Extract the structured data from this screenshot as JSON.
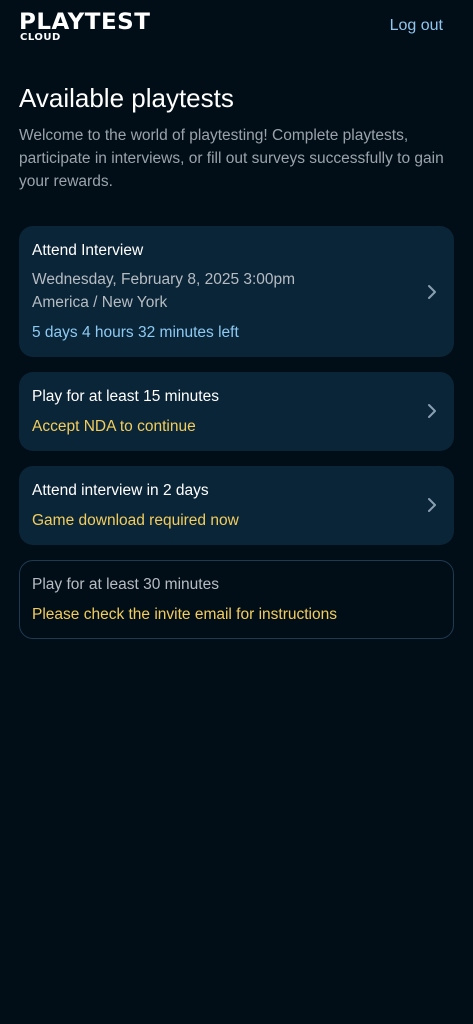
{
  "header": {
    "logo_main": "PLAYTEST",
    "logo_sub": "CLOUD",
    "logout_label": "Log out"
  },
  "page": {
    "title": "Available playtests",
    "intro": "Welcome to the world of playtesting! Complete playtests, participate in interviews, or fill out surveys successfully to gain your rewards."
  },
  "cards": [
    {
      "title": "Attend Interview",
      "date": "Wednesday, February 8, 2025 3:00pm",
      "timezone": "America / New York",
      "countdown": "5 days 4 hours 32 minutes left"
    },
    {
      "title": "Play for at least 15 minutes",
      "status": "Accept NDA to continue"
    },
    {
      "title": "Attend interview in 2 days",
      "status": "Game download required now"
    },
    {
      "title": "Play for at least 30 minutes",
      "status": "Please check the invite email for instructions"
    }
  ],
  "icons": {
    "chevron": "chevron-right-icon"
  },
  "colors": {
    "background": "#020e17",
    "card": "#0b2538",
    "link": "#8fc6ef",
    "countdown": "#8dcaf3",
    "warning": "#f2cd5d",
    "muted": "#9aa3ab"
  }
}
